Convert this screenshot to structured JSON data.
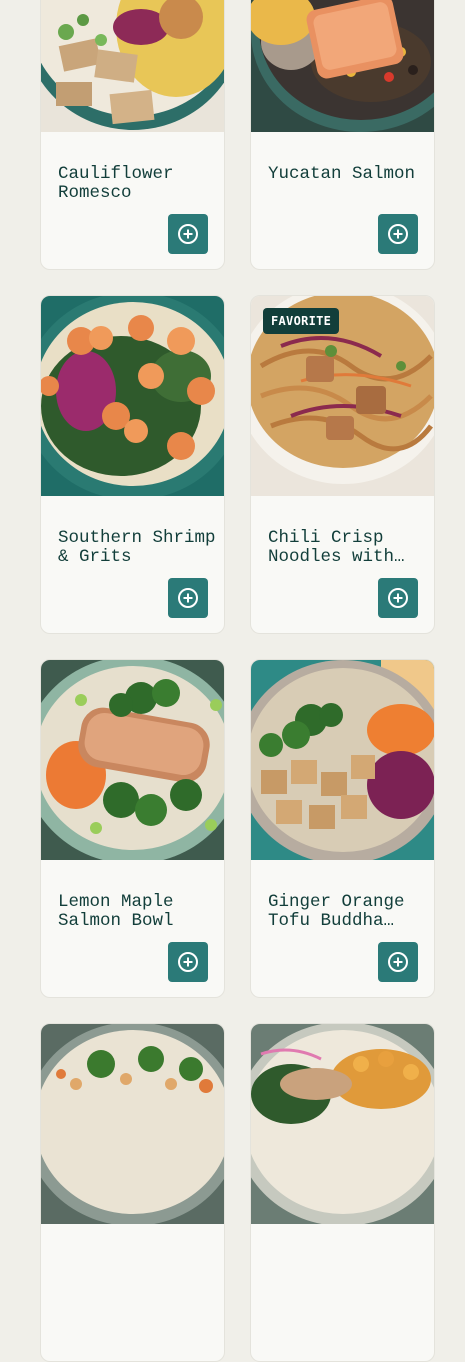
{
  "menu": {
    "items": [
      {
        "name": "Cauliflower Romesco",
        "badge": "",
        "add_icon": "plus-circle-icon",
        "photo": "cauliflower-romesco-bowl"
      },
      {
        "name": "Yucatan Salmon",
        "badge": "",
        "add_icon": "plus-circle-icon",
        "photo": "yucatan-salmon-bowl"
      },
      {
        "name": "Southern Shrimp & Grits",
        "badge": "",
        "add_icon": "plus-circle-icon",
        "photo": "shrimp-grits-bowl"
      },
      {
        "name": "Chili Crisp Noodles with…",
        "badge": "FAVORITE",
        "add_icon": "plus-circle-icon",
        "photo": "chili-crisp-noodles-bowl"
      },
      {
        "name": "Lemon Maple Salmon Bowl",
        "badge": "",
        "add_icon": "plus-circle-icon",
        "photo": "lemon-maple-salmon-bowl"
      },
      {
        "name": "Ginger Orange Tofu Buddha…",
        "badge": "",
        "add_icon": "plus-circle-icon",
        "photo": "ginger-orange-tofu-bowl"
      },
      {
        "name": "",
        "badge": "",
        "add_icon": "plus-circle-icon",
        "photo": "broccoli-cashew-bowl"
      },
      {
        "name": "",
        "badge": "",
        "add_icon": "plus-circle-icon",
        "photo": "chickpea-chicken-bowl"
      }
    ]
  },
  "colors": {
    "page_background": "#f0efe9",
    "card_background": "#f9f9f6",
    "title_text": "#123e3a",
    "add_button": "#2b7a78",
    "badge_background": "#123e3a"
  }
}
